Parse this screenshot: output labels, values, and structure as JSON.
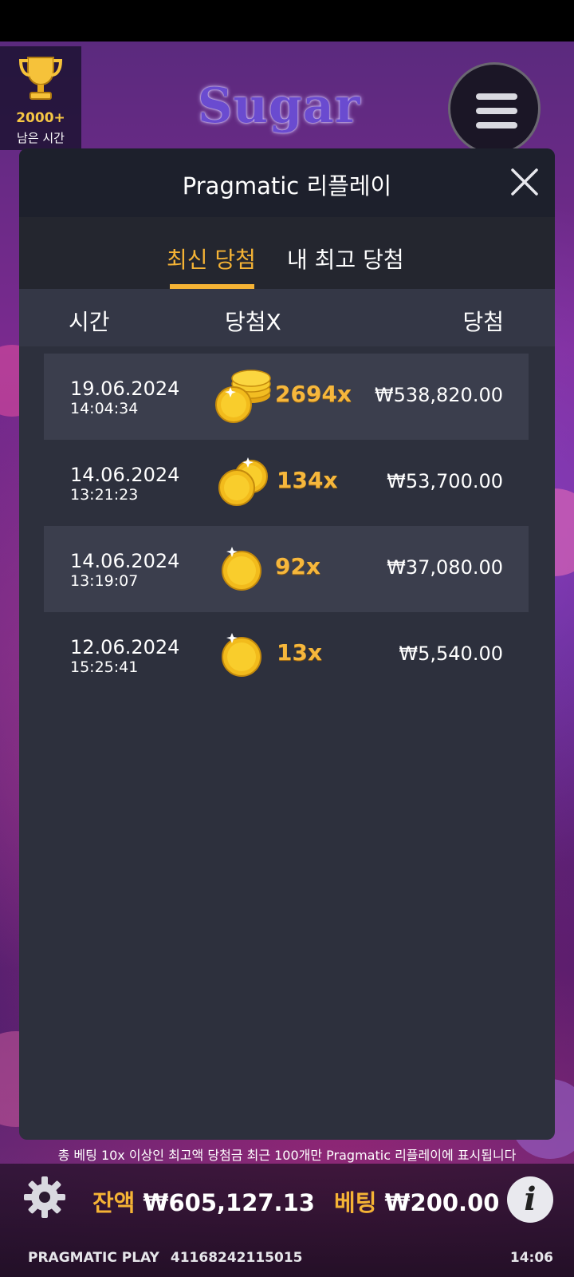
{
  "game": {
    "trophy_count": "2000+",
    "trophy_label": "남은 시간",
    "logo_text": "Sugar"
  },
  "replay": {
    "title": "Pragmatic 리플레이",
    "tabs": [
      {
        "label": "최신 당첨",
        "active": true
      },
      {
        "label": "내 최고 당첨",
        "active": false
      }
    ],
    "columns": [
      "시간",
      "당첨X",
      "당첨"
    ],
    "rows": [
      {
        "date": "19.06.2024",
        "time": "14:04:34",
        "multiplier": "2694x",
        "win": "₩538,820.00",
        "coin_icon": "coin-stack-large-icon"
      },
      {
        "date": "14.06.2024",
        "time": "13:21:23",
        "multiplier": "134x",
        "win": "₩53,700.00",
        "coin_icon": "coin-pair-icon"
      },
      {
        "date": "14.06.2024",
        "time": "13:19:07",
        "multiplier": "92x",
        "win": "₩37,080.00",
        "coin_icon": "coin-icon"
      },
      {
        "date": "12.06.2024",
        "time": "15:25:41",
        "multiplier": "13x",
        "win": "₩5,540.00",
        "coin_icon": "coin-icon"
      }
    ],
    "notice": "총 베팅 10x 이상인 최고액 당첨금 최근 100개만 Pragmatic 리플레이에 표시됩니다"
  },
  "bottom": {
    "balance_label": "잔액",
    "balance_value": "₩605,127.13",
    "bet_label": "베팅",
    "bet_value": "₩200.00"
  },
  "footer": {
    "brand": "PRAGMATIC PLAY",
    "session_id": "41168242115015",
    "clock": "14:06"
  },
  "colors": {
    "accent": "#f5b335",
    "panel": "#2d303d",
    "header": "#1d202c"
  }
}
